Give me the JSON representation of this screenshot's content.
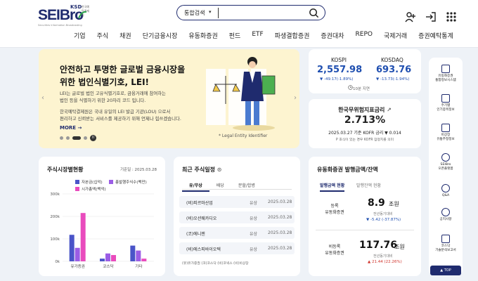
{
  "header": {
    "logo_text": "SEIBro",
    "logo_ksd": "KSD",
    "logo_ksd_sub": "한국예탁결제원",
    "logo_subtitle": "Securities Information Broadcasting",
    "search_category": "통합검색",
    "search_placeholder": ""
  },
  "nav": [
    "기업",
    "주식",
    "채권",
    "단기금융시장",
    "유동화증권",
    "펀드",
    "ETF",
    "파생결합증권",
    "증권대차",
    "REPO",
    "국제거래",
    "증권예탁통계"
  ],
  "banner": {
    "title_line1": "안전하고 투명한 글로벌 금융시장을",
    "title_line2": "위한 법인식별기호, LEI!",
    "desc1": "LEI는 글로벌 법인 고유식별기호로, 금융거래에 참여하는",
    "desc2": "법인 등을 식별하기 위한 20자리 코드 입니다.",
    "desc3": "한국예탁결제원은 국내 유일의 LEI 발급 기관(LOU) 으로서",
    "desc4": "편리하고 신뢰받는 서비스를 제공하기 위해 언제나 힘쓰겠습니다.",
    "more": "MORE →",
    "caption": "* Legal Entity Identifier",
    "pause": "II"
  },
  "index": {
    "kospi_label": "KOSPI",
    "kospi_value": "2,557.98",
    "kospi_change": "▼ -49.17(-1.89%)",
    "kosdaq_label": "KOSDAQ",
    "kosdaq_value": "693.76",
    "kosdaq_change": "▼ -13.73(-1.94%)",
    "time_note": "10분 지연"
  },
  "kofr": {
    "title": "한국무위험지표금리",
    "value": "2.713%",
    "date": "2025.03.27 기준 KOFR 금리 ▼ 0.014",
    "note": "P 호식이 있는 경우 KOFR 잠정치를 의미"
  },
  "rail": [
    {
      "label": "유동화증권\n통합정보시스템"
    },
    {
      "label": "주기별\n인기종목정보"
    },
    {
      "label": "비상장\n유통추정정보"
    },
    {
      "label": "SEIBro\n오픈플랫폼"
    },
    {
      "label": "Q&A"
    },
    {
      "label": "공지사항"
    },
    {
      "label": "코스닥\n기술분석보고서"
    }
  ],
  "top_button": "▲ TOP",
  "stock_status": {
    "title": "주식시장별현황",
    "date": "기준일 : 2025.03.28",
    "legend": [
      {
        "name": "자본금(십억)",
        "color": "#4a54c8"
      },
      {
        "name": "총발행주식수(백만)",
        "color": "#9b5de5"
      },
      {
        "name": "시가총액(백억)",
        "color": "#e94bbd"
      }
    ]
  },
  "chart_data": {
    "type": "bar",
    "categories": [
      "유가증권",
      "코스닥",
      "기타"
    ],
    "series": [
      {
        "name": "자본금(십억)",
        "values": [
          118,
          12,
          70
        ]
      },
      {
        "name": "총발행주식수(백만)",
        "values": [
          60,
          35,
          48
        ]
      },
      {
        "name": "시가총액(백억)",
        "values": [
          215,
          28,
          12
        ]
      }
    ],
    "yticks": [
      "300k",
      "200k",
      "100k",
      "0k"
    ],
    "ylim": [
      0,
      300
    ]
  },
  "recent_stocks": {
    "title": "최근 주식일정",
    "tabs": [
      "유/무상",
      "배당",
      "분할/합병"
    ],
    "rows": [
      {
        "name": "(비)피르마산업",
        "type": "유상",
        "date": "2025.03.28"
      },
      {
        "name": "(비)오션웨카디오",
        "type": "유상",
        "date": "2025.03.28"
      },
      {
        "name": "(코)에니젠",
        "type": "유상",
        "date": "2025.03.28"
      },
      {
        "name": "(비)에스피바이오텍",
        "type": "유상",
        "date": "2025.03.28"
      }
    ],
    "footnote": "(유)유가증권   (코)코스닥   (비)코넥스   (비)비상장"
  },
  "issue": {
    "title": "유동화증권 발행금액/잔액",
    "tab_active": "발행금액 현황",
    "tab_other": "발행잔액 현황",
    "reg_label": "등록\n유동화증권",
    "reg_value": "8.9",
    "reg_unit": "조원",
    "reg_sub": "전년동기대비",
    "reg_change": "▼ -5.42 (-37.87%)",
    "unreg_label": "비등록\n유동화증권",
    "unreg_value": "117.76",
    "unreg_unit": "조원",
    "unreg_sub": "전년동기대비",
    "unreg_change": "▲ 21.44 (22.26%)"
  }
}
